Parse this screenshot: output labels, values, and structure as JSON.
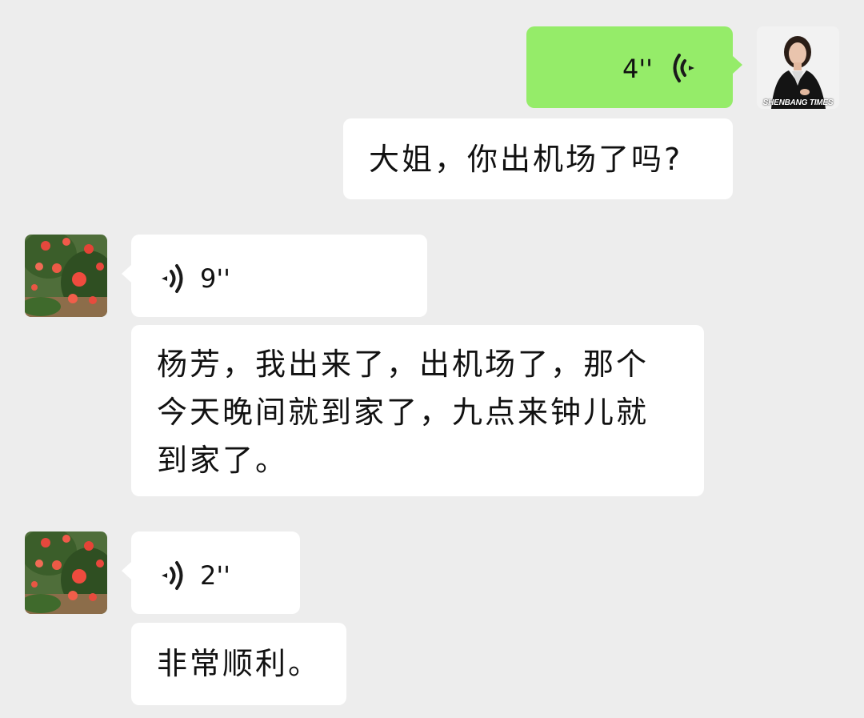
{
  "messages": [
    {
      "sender": "self",
      "type": "voice",
      "duration": "4''"
    },
    {
      "sender": "self",
      "type": "transcript",
      "text": "大姐，你出机场了吗?"
    },
    {
      "sender": "other",
      "type": "voice",
      "duration": "9''"
    },
    {
      "sender": "other",
      "type": "transcript",
      "lines": [
        "杨芳，我出来了，出机场了，那个",
        "今天晚间就到家了，九点来钟儿就",
        "到家了。"
      ]
    },
    {
      "sender": "other",
      "type": "voice",
      "duration": "2''"
    },
    {
      "sender": "other",
      "type": "transcript",
      "text": "非常顺利。"
    }
  ],
  "self_avatar": {
    "watermark": "SHENBANG TIMES",
    "icon": "woman-portrait-avatar"
  },
  "other_avatar": {
    "icon": "red-roses-avatar"
  },
  "colors": {
    "background": "#ededed",
    "self_bubble": "#95ec69",
    "other_bubble": "#ffffff",
    "text": "#111111"
  }
}
